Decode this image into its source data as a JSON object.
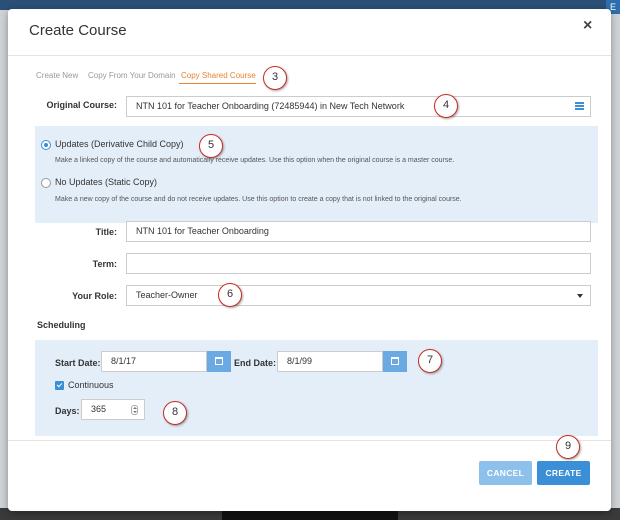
{
  "window": {
    "top_right_glyph": "E"
  },
  "modal": {
    "title": "Create Course",
    "close_glyph": "×"
  },
  "tabs": [
    {
      "label": "Create New",
      "active": false
    },
    {
      "label": "Copy From Your Domain",
      "active": false
    },
    {
      "label": "Copy Shared Course",
      "active": true
    }
  ],
  "original_course": {
    "label": "Original Course:",
    "value": "NTN 101 for Teacher Onboarding (72485944) in New Tech Network",
    "icon": "list-icon"
  },
  "copy_options": [
    {
      "label": "Updates (Derivative Child Copy)",
      "checked": true,
      "description": "Make a linked copy of the course and automatically receive updates. Use this option when the original course is a master course."
    },
    {
      "label": "No Updates (Static Copy)",
      "checked": false,
      "description": "Make a new copy of the course and do not receive updates. Use this option to create a copy that is not linked to the original course."
    }
  ],
  "title_field": {
    "label": "Title:",
    "value": "NTN 101 for Teacher Onboarding"
  },
  "term_field": {
    "label": "Term:",
    "value": ""
  },
  "role_field": {
    "label": "Your Role:",
    "value": "Teacher-Owner"
  },
  "scheduling": {
    "title": "Scheduling",
    "start_label": "Start Date:",
    "start_value": "8/1/17",
    "end_label": "End Date:",
    "end_value": "8/1/99",
    "continuous_label": "Continuous",
    "continuous_checked": true,
    "days_label": "Days:",
    "days_value": "365"
  },
  "callouts": [
    "3",
    "4",
    "5",
    "6",
    "7",
    "8",
    "9"
  ],
  "buttons": {
    "cancel": "CANCEL",
    "create": "CREATE"
  },
  "colors": {
    "accent": "#3a8fd6",
    "active_tab": "#e8832f",
    "panel_bg": "#e4eef9",
    "callout_border": "#c62d22"
  }
}
